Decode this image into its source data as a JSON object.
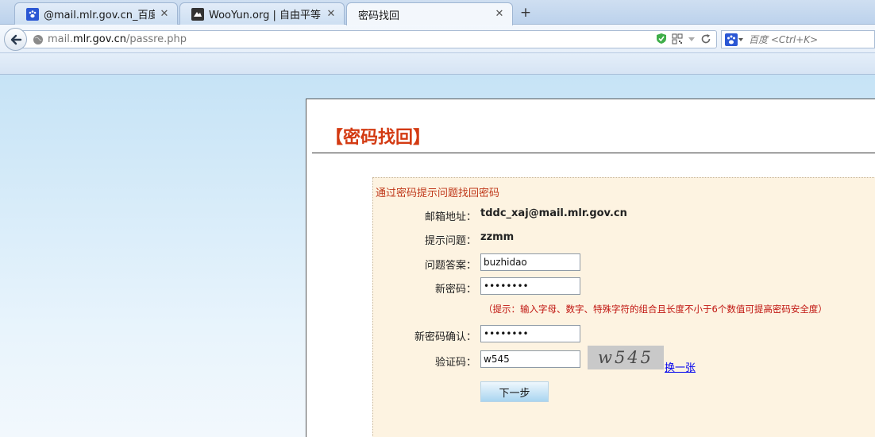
{
  "browser": {
    "tabs": [
      {
        "title": "@mail.mlr.gov.cn_百度搜...",
        "icon": "baidu-paw-icon",
        "active": false
      },
      {
        "title": "WooYun.org | 自由平等...",
        "icon": "wooyun-icon",
        "active": false
      },
      {
        "title": "密码找回",
        "icon": "",
        "active": true
      }
    ],
    "new_tab_label": "+",
    "close_label": "✕",
    "address": {
      "url_host_prefix": "mail.",
      "url_host": "mlr.gov.cn",
      "url_path": "/passre.php"
    },
    "search": {
      "placeholder": "百度 <Ctrl+K>",
      "engine_icon": "baidu-paw-icon"
    }
  },
  "page": {
    "title": "【密码找回】",
    "form": {
      "lead": "通过密码提示问题找回密码",
      "email": {
        "label": "邮箱地址：",
        "value": "tddc_xaj@mail.mlr.gov.cn"
      },
      "question": {
        "label": "提示问题：",
        "value": "zzmm"
      },
      "answer": {
        "label": "问题答案：",
        "value": "buzhidao"
      },
      "new_password": {
        "label": "新密码：",
        "value": "12345678"
      },
      "hint": "（提示：输入字母、数字、特殊字符的组合且长度不小于6个数值可提高密码安全度）",
      "confirm_password": {
        "label": "新密码确认：",
        "value": "12345678"
      },
      "captcha": {
        "label": "验证码：",
        "value": "w545",
        "image_text": "w545",
        "refresh_label": "换一张"
      },
      "submit_label": "下一步"
    }
  },
  "colors": {
    "accent_red": "#d33a12",
    "hint_red": "#c0140f",
    "form_bg": "#fdf3e1",
    "page_bg": "#c6e3f6"
  }
}
